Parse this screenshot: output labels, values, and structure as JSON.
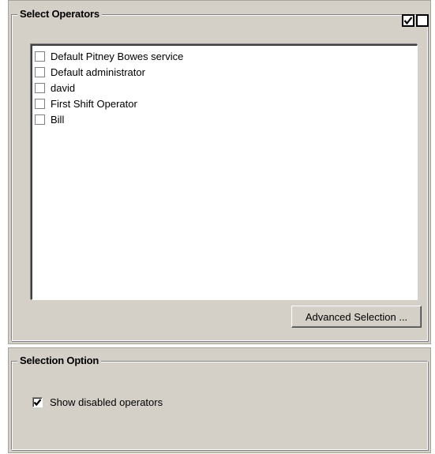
{
  "operators_group": {
    "legend": "Select Operators",
    "select_all_icon": "checked-box-icon",
    "deselect_all_icon": "unchecked-box-icon",
    "items": [
      {
        "label": "Default Pitney Bowes service",
        "checked": false
      },
      {
        "label": "Default administrator",
        "checked": false
      },
      {
        "label": "david",
        "checked": false
      },
      {
        "label": "First Shift Operator",
        "checked": false
      },
      {
        "label": "Bill",
        "checked": false
      }
    ],
    "advanced_button_label": "Advanced Selection ..."
  },
  "option_group": {
    "legend": "Selection Option",
    "show_disabled": {
      "label": "Show disabled operators",
      "checked": true
    }
  },
  "colors": {
    "panel_bg": "#d4d0c8",
    "list_bg": "#ffffff",
    "text": "#000000"
  }
}
